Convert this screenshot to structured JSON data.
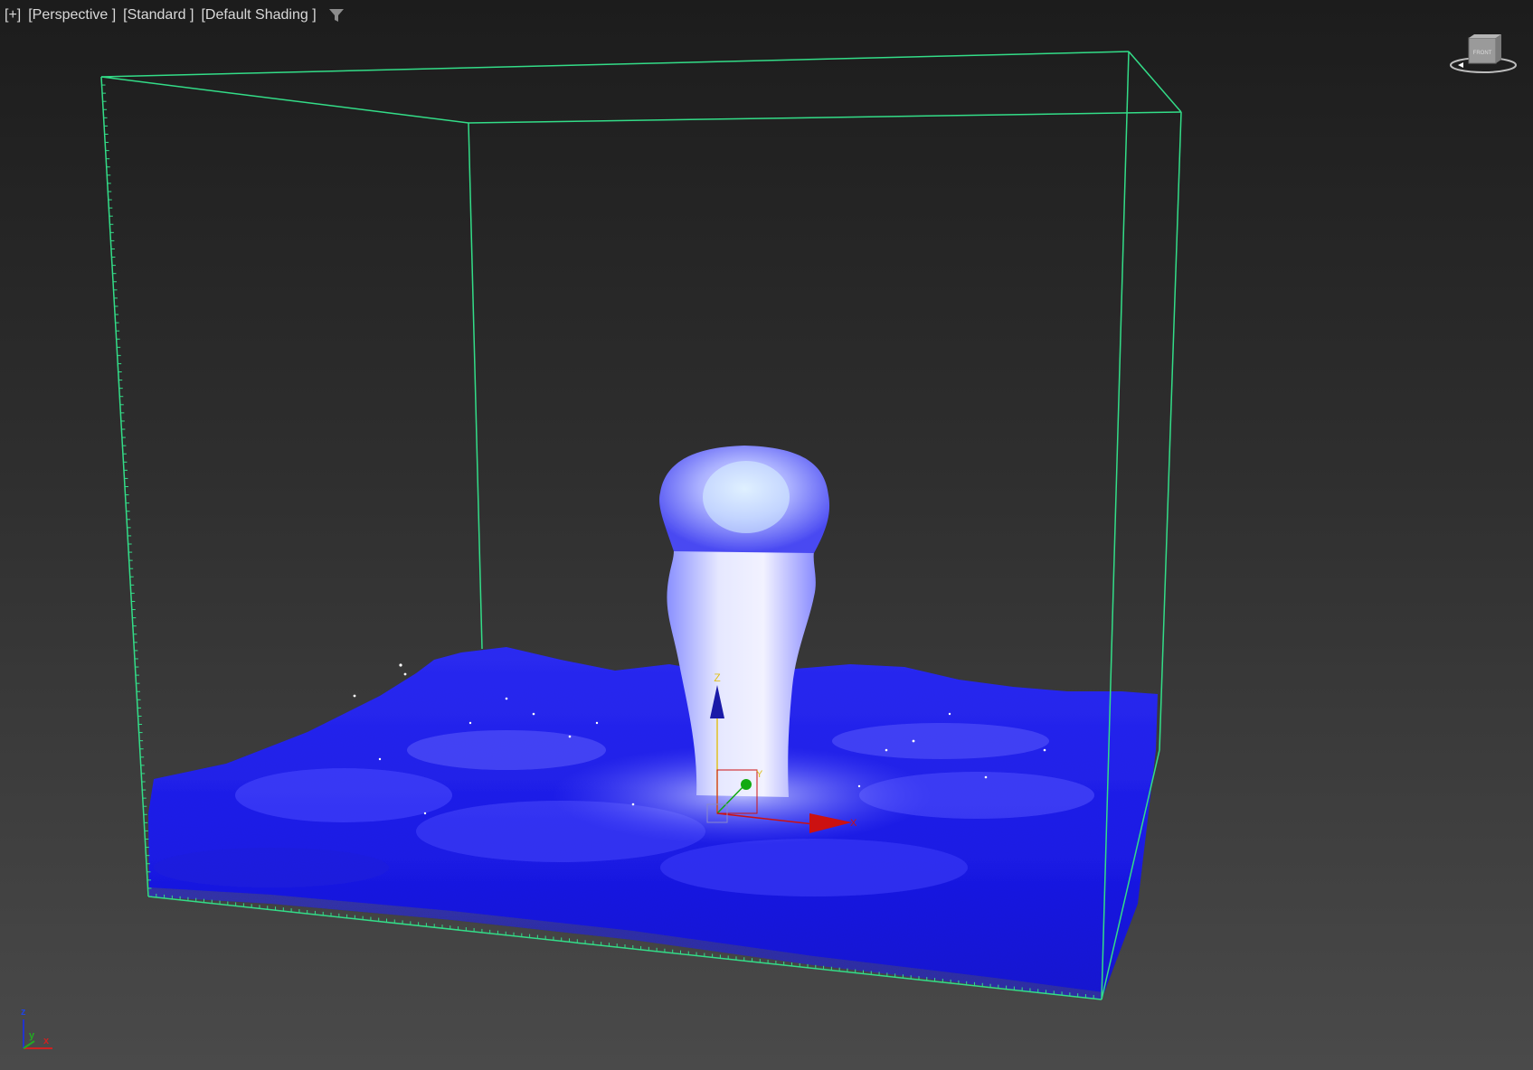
{
  "viewport": {
    "menus": [
      {
        "id": "plus",
        "label": "[+]"
      },
      {
        "id": "view",
        "label": "[Perspective ]"
      },
      {
        "id": "style",
        "label": "[Standard ]"
      },
      {
        "id": "shading",
        "label": "[Default Shading ]"
      }
    ],
    "filter_icon": "filter-funnel-icon"
  },
  "viewcube": {
    "face_label": "FRONT",
    "icon": "viewcube-icon"
  },
  "gizmo": {
    "z_label": "Z",
    "y_label": "Y",
    "x_label": "X",
    "colors": {
      "x": "#cc1111",
      "y": "#11aa11",
      "z": "#1a1aa8",
      "center": "#e0c020"
    }
  },
  "axis_tripod": {
    "z_label": "z",
    "y_label": "y",
    "x_label": "x",
    "colors": {
      "x": "#cc2222",
      "y": "#22aa22",
      "z": "#2233cc"
    }
  },
  "scene": {
    "bounding_box_color": "#33dd88",
    "fluid_color": "#1a1ae6",
    "foam_color": "#e6e6ff",
    "background_top": "#1c1c1c",
    "background_bottom": "#4a4a4a"
  }
}
